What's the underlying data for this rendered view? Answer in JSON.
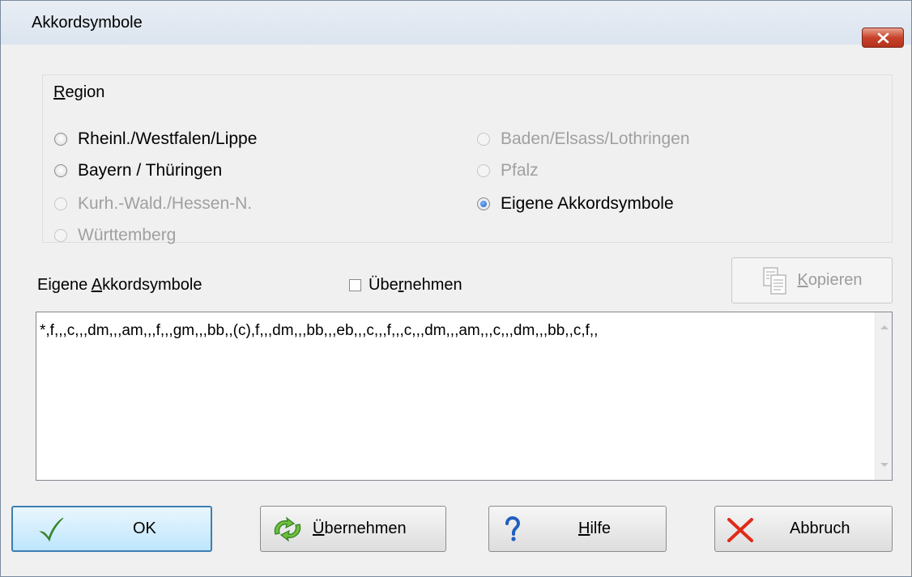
{
  "window": {
    "title": "Akkordsymbole"
  },
  "region": {
    "legend": "Region",
    "options": [
      {
        "label": "Rheinl./Westfalen/Lippe",
        "enabled": true,
        "checked": false
      },
      {
        "label": "Bayern / Thüringen",
        "enabled": true,
        "checked": false
      },
      {
        "label": "Kurh.-Wald./Hessen-N.",
        "enabled": false,
        "checked": false
      },
      {
        "label": "Württemberg",
        "enabled": false,
        "checked": false
      },
      {
        "label": "Baden/Elsass/Lothringen",
        "enabled": false,
        "checked": false
      },
      {
        "label": "Pfalz",
        "enabled": false,
        "checked": false
      },
      {
        "label": "Eigene Akkordsymbole",
        "enabled": true,
        "checked": true
      }
    ]
  },
  "custom": {
    "label": "Eigene Akkordsymbole",
    "adopt_checkbox_label": "Übernehmen",
    "adopt_checked": false,
    "copy_button": "Kopieren",
    "text": "*,f,,,c,,,dm,,,am,,,f,,,gm,,,bb,,(c),f,,,dm,,,bb,,,eb,,,c,,,f,,,c,,,dm,,,am,,,c,,,dm,,,bb,,c,f,,"
  },
  "buttons": {
    "ok": "OK",
    "apply": "Übernehmen",
    "help": "Hilfe",
    "cancel": "Abbruch"
  },
  "icons": {
    "close": "close-icon",
    "ok": "checkmark-icon",
    "apply": "refresh-arrows-icon",
    "help": "question-mark-icon",
    "cancel": "red-x-icon",
    "copy": "copy-documents-icon"
  }
}
